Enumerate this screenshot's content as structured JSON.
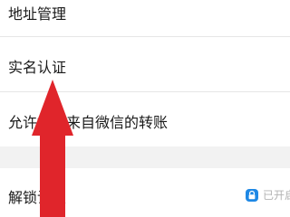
{
  "settings": {
    "items": [
      {
        "label": "地址管理"
      },
      {
        "label": "实名认证"
      },
      {
        "label": "允许接收来自微信的转账"
      },
      {
        "label": "解锁设置",
        "status": "已开启"
      }
    ]
  },
  "colors": {
    "accent": "#1e88e5",
    "annotation_arrow": "#e0252b",
    "separator": "#f2f2f2"
  },
  "icons": {
    "lock_status": "lock-icon",
    "annotation": "red-arrow"
  }
}
